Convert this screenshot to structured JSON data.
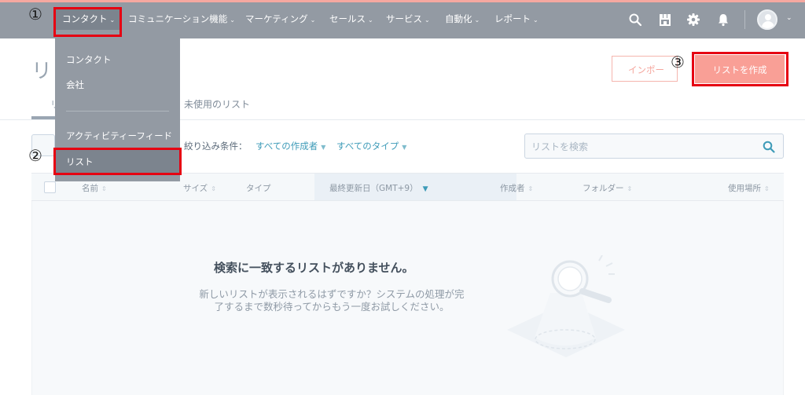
{
  "nav": {
    "items": [
      {
        "label": "コンタクト"
      },
      {
        "label": "コミュニケーション機能"
      },
      {
        "label": "マーケティング"
      },
      {
        "label": "セールス"
      },
      {
        "label": "サービス"
      },
      {
        "label": "自動化"
      },
      {
        "label": "レポート"
      }
    ],
    "icons": [
      "search-icon",
      "marketplace-icon",
      "gear-icon",
      "bell-icon"
    ]
  },
  "dropdown": {
    "items": [
      {
        "label": "コンタクト"
      },
      {
        "label": "会社"
      },
      {
        "label": "アクティビティーフィード"
      },
      {
        "label": "リスト"
      }
    ]
  },
  "markers": [
    "①",
    "②",
    "③"
  ],
  "page": {
    "title": "リ",
    "tabs": [
      {
        "label": "リ"
      },
      {
        "label": "未使用のリスト"
      }
    ],
    "import_label": "インポー",
    "create_label": "リストを作成"
  },
  "filters": {
    "label": "絞り込み条件：",
    "creator": "すべての作成者",
    "type": "すべてのタイプ"
  },
  "search": {
    "placeholder": "リストを検索"
  },
  "table": {
    "columns": [
      {
        "label": "名前"
      },
      {
        "label": "サイズ"
      },
      {
        "label": "タイプ"
      },
      {
        "label": "最終更新日（GMT+9）"
      },
      {
        "label": "作成者"
      },
      {
        "label": "フォルダー"
      },
      {
        "label": "使用場所"
      }
    ]
  },
  "empty_state": {
    "title": "検索に一致するリストがありません。",
    "description_line1": "新しいリストが表示されるはずですか？システムの処理が完",
    "description_line2": "了するまで数秒待ってからもう一度お試しください。"
  },
  "colors": {
    "highlight": "#e60012",
    "accent": "#f99f96",
    "link": "#3e9bb8"
  }
}
